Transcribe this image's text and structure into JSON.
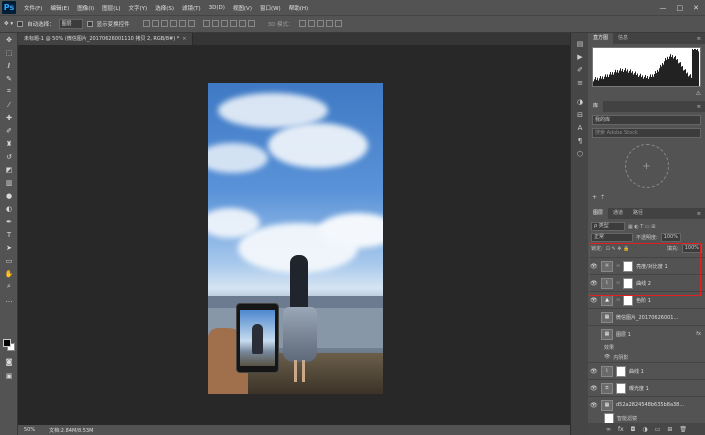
{
  "app": {
    "logo": "Ps"
  },
  "menu": [
    "文件(F)",
    "编辑(E)",
    "图像(I)",
    "图层(L)",
    "文字(Y)",
    "选择(S)",
    "滤镜(T)",
    "3D(D)",
    "视图(V)",
    "窗口(W)",
    "帮助(H)"
  ],
  "window_controls": [
    "—",
    "□",
    "✕"
  ],
  "options": {
    "auto_select": "自动选择：",
    "auto_select_value": "图层",
    "show_transform": "显示变换控件",
    "mode_3d": "3D 模式："
  },
  "document": {
    "tab_title": "未标题-1 @ 50% (微信图片_20170626001110 拷贝 2, RGB/8#) *",
    "close": "×",
    "zoom": "50%",
    "doc_info": "文档:2.84M/8.53M"
  },
  "panels": {
    "histogram": {
      "tabs": [
        "直方图",
        "信息"
      ]
    },
    "libraries": {
      "tabs": [
        "库"
      ],
      "library": "我的库",
      "search_placeholder": "搜索 Adobe Stock"
    },
    "layers": {
      "tabs": [
        "图层",
        "通道",
        "路径"
      ],
      "filter": "ρ 类型",
      "blend_mode": "正常",
      "opacity_label": "不透明度:",
      "opacity": "100%",
      "lock_label": "锁定:",
      "fill_label": "填充:",
      "fill": "100%",
      "items": [
        {
          "name": "亮度/对比度 1",
          "icon": "☼"
        },
        {
          "name": "曲线 2",
          "icon": "⌇"
        },
        {
          "name": "色阶 1",
          "icon": "▲"
        },
        {
          "name": "微信图片_20170626001...",
          "icon": "▦"
        },
        {
          "name": "图层 1",
          "icon": "▦",
          "fx": "fx"
        },
        {
          "name": "效果",
          "sub": true
        },
        {
          "name": "内阴影",
          "sub": true
        },
        {
          "name": "曲线 1",
          "icon": "⌇"
        },
        {
          "name": "曝光度 1",
          "icon": "±"
        },
        {
          "name": "d52a2824548b635b8a38...",
          "icon": "▦"
        },
        {
          "name": "智能滤镜",
          "sub": true
        }
      ]
    }
  }
}
